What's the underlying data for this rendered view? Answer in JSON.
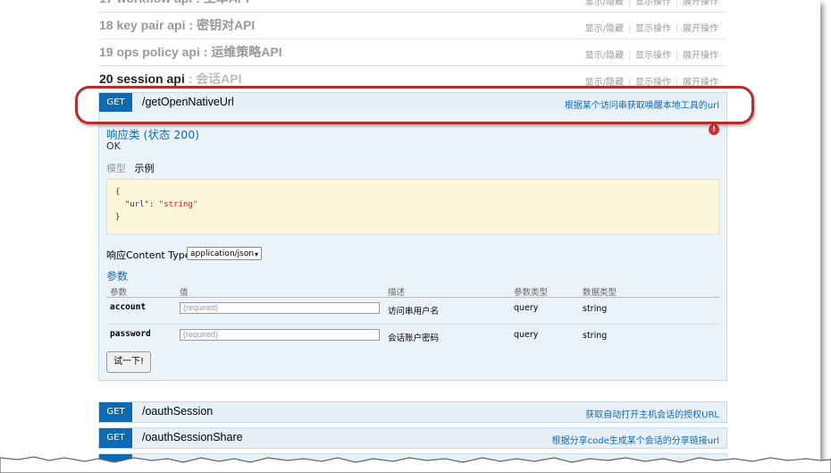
{
  "groups": [
    {
      "title": "17 workflow api : 工单API",
      "links": [
        "显示/隐藏",
        "显示操作",
        "展开操作"
      ]
    },
    {
      "title": "18 key pair api : 密钥对API",
      "links": [
        "显示/隐藏",
        "显示操作",
        "展开操作"
      ]
    },
    {
      "title": "19 ops policy api : 运维策略API",
      "links": [
        "显示/隐藏",
        "显示操作",
        "展开操作"
      ]
    },
    {
      "title_main": "20 session api",
      "title_sep": " : ",
      "title_tail": "会话API",
      "links": [
        "显示/隐藏",
        "显示操作",
        "展开操作"
      ]
    }
  ],
  "operations": [
    {
      "method": "GET",
      "path": "/getOpenNativeUrl",
      "summary": "根据某个访问串获取唤醒本地工具的url"
    },
    {
      "method": "GET",
      "path": "/oauthSession",
      "summary": "获取自动打开主机会话的授权URL"
    },
    {
      "method": "GET",
      "path": "/oauthSessionShare",
      "summary": "根据分享code生成某个会话的分享链接url"
    }
  ],
  "response": {
    "title": "响应类 (状态 200)",
    "status_text": "OK",
    "tab_model": "模型",
    "tab_example": "示例",
    "sample_lines": [
      "{",
      "  \"url\": ",
      "\"string\"",
      "}"
    ],
    "content_type_label": "响应Content Type",
    "content_type_value": "application/json"
  },
  "parameters": {
    "title": "参数",
    "headers": [
      "参数",
      "值",
      "描述",
      "参数类型",
      "数据类型"
    ],
    "rows": [
      {
        "name": "account",
        "placeholder": "(required)",
        "description": "访问串用户名",
        "param_type": "query",
        "data_type": "string"
      },
      {
        "name": "password",
        "placeholder": "(required)",
        "description": "会话账户密码",
        "param_type": "query",
        "data_type": "string"
      }
    ],
    "try_button": "试一下!"
  },
  "colors": {
    "get_method": "#0f6ab4",
    "op_background": "#e7f0f7",
    "highlight_ring": "#b03030",
    "sample_background": "#fcf6db",
    "error_icon": "#d32f2f"
  },
  "icons": {
    "error": "exclamation-circle-icon",
    "select": "chevron-down-icon"
  }
}
